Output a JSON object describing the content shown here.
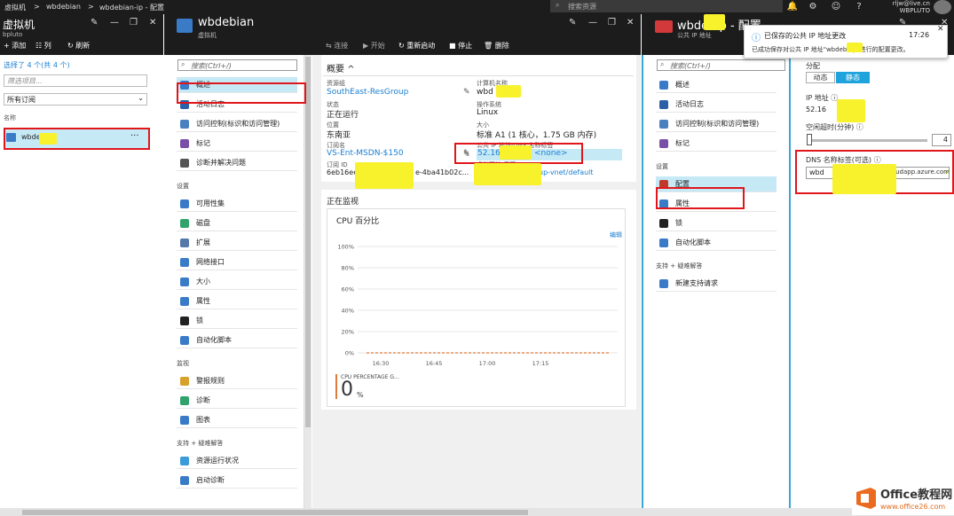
{
  "topbar": {
    "crumbs": [
      "虚拟机",
      ">",
      "wbdebian",
      ">",
      "wbdebian-ip - 配置"
    ],
    "search_placeholder": "搜索资源",
    "user_email": "rljw@live.cn",
    "user_org": "WBPLUTO"
  },
  "blade1": {
    "title": "虚拟机",
    "subtitle": "bpluto",
    "cmd_add": "添加",
    "cmd_columns": "列",
    "cmd_refresh": "刷新",
    "selected_text": "选择了 4 个(共 4 个)",
    "filter_placeholder": "筛选项目...",
    "subscription": "所有订阅",
    "name_header": "名称",
    "vm_name": "wbdeb",
    "more": "···"
  },
  "blade2": {
    "title": "wbdebian",
    "subtitle": "虚拟机",
    "search_placeholder": "搜索(Ctrl+/)",
    "items": [
      {
        "label": "概述",
        "color": "#3a7bc8"
      },
      {
        "label": "活动日志",
        "color": "#2b5fa8"
      },
      {
        "label": "访问控制(标识和访问管理)",
        "color": "#4a7fc0"
      },
      {
        "label": "标记",
        "color": "#7a4fa8"
      },
      {
        "label": "诊断并解决问题",
        "color": "#555555"
      }
    ],
    "section_settings": "设置",
    "settings_items": [
      {
        "label": "可用性集",
        "color": "#3a7bc8"
      },
      {
        "label": "磁盘",
        "color": "#2fa36b"
      },
      {
        "label": "扩展",
        "color": "#5577aa"
      },
      {
        "label": "网络接口",
        "color": "#3a7bc8"
      },
      {
        "label": "大小",
        "color": "#3a7bc8"
      },
      {
        "label": "属性",
        "color": "#3a7bc8"
      },
      {
        "label": "锁",
        "color": "#222222"
      },
      {
        "label": "自动化脚本",
        "color": "#3a7bc8"
      }
    ],
    "section_monitor": "监视",
    "monitor_items": [
      {
        "label": "警报规则",
        "color": "#d8a12b"
      },
      {
        "label": "诊断",
        "color": "#2fa36b"
      },
      {
        "label": "图表",
        "color": "#3a7bc8"
      }
    ],
    "section_support": "支持 + 疑难解答",
    "support_items": [
      {
        "label": "资源运行状况",
        "color": "#3a9bd8"
      },
      {
        "label": "启动诊断",
        "color": "#3a7bc8"
      }
    ]
  },
  "blade3": {
    "cmd_connect": "连接",
    "cmd_start": "开始",
    "cmd_restart": "重新启动",
    "cmd_stop": "停止",
    "cmd_delete": "删除",
    "overview": "概要",
    "resource_group_label": "资源组",
    "resource_group": "SouthEast-ResGroup",
    "status_label": "状态",
    "status": "正在运行",
    "location_label": "位置",
    "location": "东南亚",
    "subscription_label": "订阅名",
    "subscription": "VS-Ent-MSDN-$150",
    "subscription_id_label": "订阅 ID",
    "subscription_id": "6eb16eeb",
    "subscription_id_tail": "e-4ba41b02c...",
    "computer_label": "计算机名称",
    "computer": "wbd",
    "os_label": "操作系统",
    "os": "Linux",
    "size_label": "大小",
    "size": "标准 A1 (1 核心，1.75 GB 内存)",
    "ip_label": "公共 IP 地址/DNS 名称标签",
    "ip": "52.163.231",
    "ip_tail": "<none>",
    "vnet_label": "虚拟网络/子网",
    "vnet": "up-vnet/default",
    "monitoring": "正在监视",
    "chart_title": "CPU 百分比",
    "edit": "编辑",
    "metric_name": "CPU PERCENTAGE G...",
    "metric_value": "0",
    "metric_unit": "%"
  },
  "chart_data": {
    "type": "line",
    "title": "CPU 百分比",
    "yticks": [
      "100%",
      "80%",
      "60%",
      "40%",
      "20%",
      "0%"
    ],
    "ylim": [
      0,
      100
    ],
    "xticks": [
      "16:30",
      "16:45",
      "17:00",
      "17:15"
    ],
    "series": [
      {
        "values": [
          0,
          0,
          0,
          0,
          0
        ],
        "color": "#e07b39"
      }
    ]
  },
  "blade4": {
    "title": "wbde",
    "title_tail": "-ip - 配置",
    "subtitle": "公共 IP 地址",
    "search_placeholder": "搜索(Ctrl+/)",
    "items": [
      {
        "label": "概述",
        "color": "#3a7bc8"
      },
      {
        "label": "活动日志",
        "color": "#2b5fa8"
      },
      {
        "label": "访问控制(标识和访问管理)",
        "color": "#4a7fc0"
      },
      {
        "label": "标记",
        "color": "#7a4fa8"
      }
    ],
    "section_settings": "设置",
    "settings_items": [
      {
        "label": "配置",
        "color": "#c0392b"
      },
      {
        "label": "属性",
        "color": "#3a7bc8"
      },
      {
        "label": "锁",
        "color": "#222222"
      },
      {
        "label": "自动化脚本",
        "color": "#3a7bc8"
      }
    ],
    "section_support": "支持 + 疑难解答",
    "support_items": [
      {
        "label": "新建支持请求",
        "color": "#3a7bc8"
      }
    ]
  },
  "config": {
    "assignment_label": "分配",
    "dynamic": "动态",
    "static": "静态",
    "ip_label": "IP 地址",
    "ip": "52.16",
    "idle_label": "空闲超时(分钟)",
    "idle_value": "4",
    "dns_label": "DNS 名称标签(可选)",
    "dns_prefix": "wbd",
    "dns_suffix": "oudapp.azure.com"
  },
  "notification": {
    "title": "已保存的公共 IP 地址更改",
    "time": "17:26",
    "body": "已成功保存对公共 IP 地址\"wbdeb    -ip\"进行的配置更改。"
  },
  "watermark": {
    "text": "Office教程网",
    "url": "www.office26.com"
  }
}
